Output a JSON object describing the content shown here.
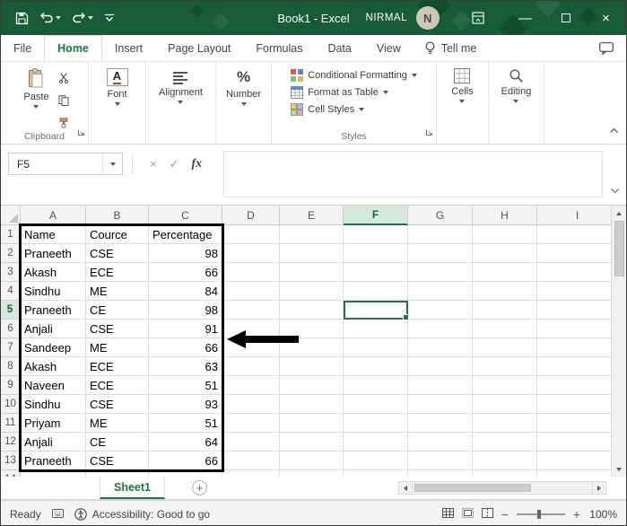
{
  "titlebar": {
    "title": "Book1 - Excel",
    "user_name": "NIRMAL",
    "avatar_initial": "N"
  },
  "tabs": {
    "items": [
      "File",
      "Home",
      "Insert",
      "Page Layout",
      "Formulas",
      "Data",
      "View"
    ],
    "active": "Home",
    "tell_me": "Tell me"
  },
  "ribbon": {
    "paste_label": "Paste",
    "font_label": "Font",
    "alignment_label": "Alignment",
    "number_label": "Number",
    "conditional_formatting_label": "Conditional Formatting",
    "format_as_table_label": "Format as Table",
    "cell_styles_label": "Cell Styles",
    "cells_label": "Cells",
    "editing_label": "Editing",
    "clipboard_group_label": "Clipboard",
    "styles_group_label": "Styles"
  },
  "formula_bar": {
    "name_box_value": "F5",
    "fx_label": "fx",
    "cancel_glyph": "×",
    "enter_glyph": "✓",
    "formula_value": ""
  },
  "grid": {
    "column_headers": [
      "A",
      "B",
      "C",
      "D",
      "E",
      "F",
      "G",
      "H",
      "I"
    ],
    "selected_cell": "F5",
    "selected_column": "F",
    "selected_row": 5,
    "bordered_range": "A1:C13",
    "rows": [
      {
        "n": "1",
        "cells": [
          "Name",
          "Cource",
          "Percentage"
        ]
      },
      {
        "n": "2",
        "cells": [
          "Praneeth",
          "CSE",
          "98"
        ]
      },
      {
        "n": "3",
        "cells": [
          "Akash",
          "ECE",
          "66"
        ]
      },
      {
        "n": "4",
        "cells": [
          "Sindhu",
          "ME",
          "84"
        ]
      },
      {
        "n": "5",
        "cells": [
          "Praneeth",
          "CE",
          "98"
        ]
      },
      {
        "n": "6",
        "cells": [
          "Anjali",
          "CSE",
          "91"
        ]
      },
      {
        "n": "7",
        "cells": [
          "Sandeep",
          "ME",
          "66"
        ]
      },
      {
        "n": "8",
        "cells": [
          "Akash",
          "ECE",
          "63"
        ]
      },
      {
        "n": "9",
        "cells": [
          "Naveen",
          "ECE",
          "51"
        ]
      },
      {
        "n": "10",
        "cells": [
          "Sindhu",
          "CSE",
          "93"
        ]
      },
      {
        "n": "11",
        "cells": [
          "Priyam",
          "ME",
          "51"
        ]
      },
      {
        "n": "12",
        "cells": [
          "Anjali",
          "CE",
          "64"
        ]
      },
      {
        "n": "13",
        "cells": [
          "Praneeth",
          "CSE",
          "66"
        ]
      }
    ]
  },
  "sheet_bar": {
    "active_sheet": "Sheet1",
    "new_sheet_glyph": "+"
  },
  "status_bar": {
    "mode": "Ready",
    "accessibility": "Accessibility: Good to go",
    "zoom": "100%",
    "zoom_out_glyph": "−",
    "zoom_in_glyph": "+"
  },
  "colors": {
    "excel_green": "#217346",
    "titlebar_green": "#185c37",
    "selection_header_fill": "#d5e8dd",
    "annotation_black": "#000000"
  }
}
